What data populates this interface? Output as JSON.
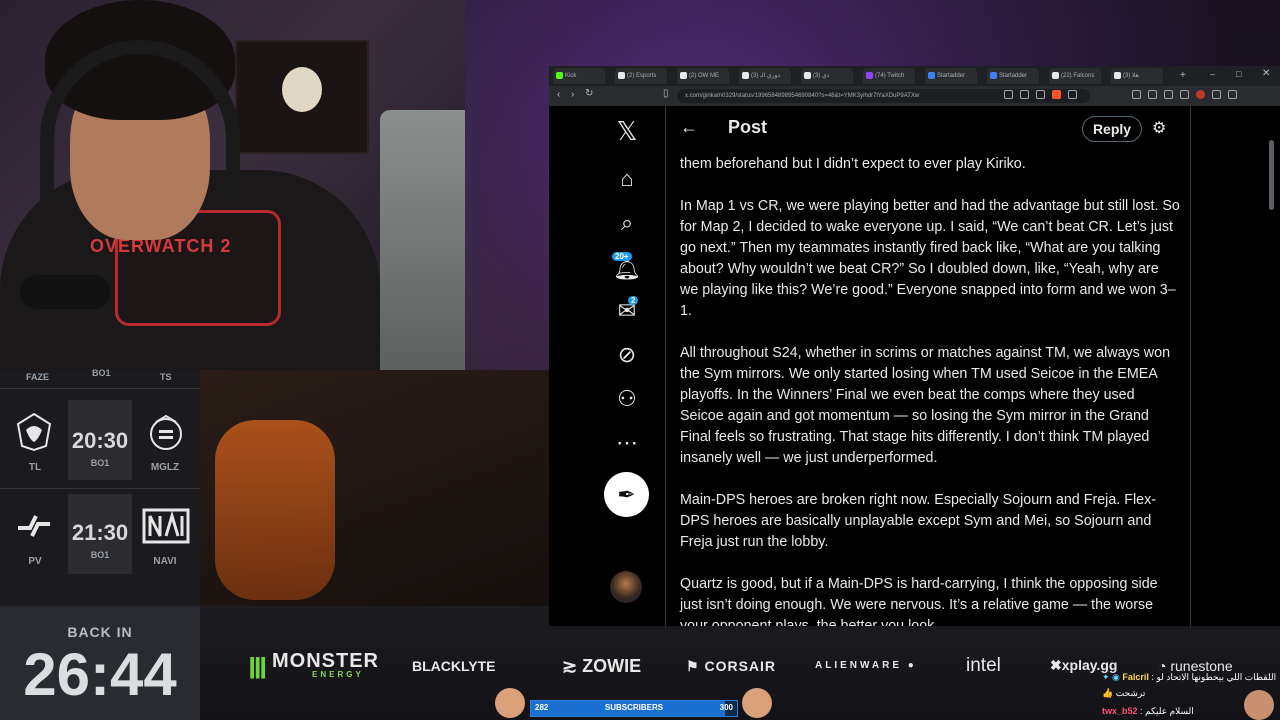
{
  "colors": {
    "accent": "#1d9bf0",
    "x_bg": "#000000",
    "x_text": "#e7e9ea",
    "sub_fill": "#1b6fd0"
  },
  "webcam": {
    "shirt_text": "OVERWATCH 2"
  },
  "match_panel": {
    "header": {
      "left": "FAZE",
      "mid": "BO1",
      "right": "TS"
    },
    "matches": [
      {
        "team1": "TL",
        "time": "20:30",
        "format": "BO1",
        "team2": "MGLZ"
      },
      {
        "team1": "PV",
        "time": "21:30",
        "format": "BO1",
        "team2": "NAVI"
      }
    ]
  },
  "back_in": {
    "label": "BACK IN",
    "time": "26:44"
  },
  "sponsors": {
    "monster": "MONSTER",
    "monster_sub": "ENERGY",
    "blacklyte": "BLACKLYTE",
    "zowie": "ZOWIE",
    "corsair": "CORSAIR",
    "alienware": "ALIENWARE",
    "intel": "intel",
    "xplay": "xplay.gg",
    "runestone": "runestone"
  },
  "subscribers": {
    "label": "SUBSCRIBERS",
    "current": "282",
    "goal": "300",
    "progress": 0.94
  },
  "browser": {
    "tabs": [
      "Kick",
      "(2) Esports",
      "(2) OW ME",
      "(3) دوري الـ",
      "(3) دي",
      "(74) Twitch",
      "Startadder",
      "Startadder",
      "(22) Falcons",
      "هلا (3)"
    ],
    "url": "x.com/ginkam0329/status/1996584898954690840?s=46&t=YMK3yihdr7lYaXDuP9ATXw"
  },
  "x_page": {
    "post_title": "Post",
    "reply_label": "Reply",
    "notification_badge": "20+",
    "message_badge": "2",
    "paragraphs": [
      "them beforehand but I didn’t expect to ever play Kiriko.",
      "In Map 1 vs CR, we were playing better and had the advantage but still lost. So for Map 2, I decided to wake everyone up. I said, “We can’t beat CR. Let’s just go next.” Then my teammates instantly fired back like, “What are you talking about? Why wouldn’t we beat CR?” So I doubled down, like, “Yeah, why are we playing like this? We’re good.” Everyone snapped into form and we won 3–1.",
      "All throughout S24, whether in scrims or matches against TM, we always won the Sym mirrors. We only started losing when TM used Seicoe in the EMEA playoffs. In the Winners’ Final we even beat the comps where they used Seicoe again and got momentum — so losing the Sym mirror in the Grand Final feels so frustrating. That stage hits differently. I don’t think TM played insanely well — we just underperformed.",
      "Main-DPS heroes are broken right now. Especially Sojourn and Freja. Flex-DPS heroes are basically unplayable except Sym and Mei, so Sojourn and Freja just run the lobby.",
      "Quartz is good, but if a Main-DPS is hard-carrying, I think the opposing side just isn’t doing enough. We were nervous. It’s a relative game — the worse your opponent plays, the better you look."
    ]
  },
  "chat": [
    {
      "name": "Falcril",
      "message": "اللقطات اللي بيحطونها الاتحاد لو"
    },
    {
      "name": "",
      "message": "ترشحت"
    },
    {
      "name": "twx_b52",
      "message": "السلام عليكم"
    }
  ]
}
